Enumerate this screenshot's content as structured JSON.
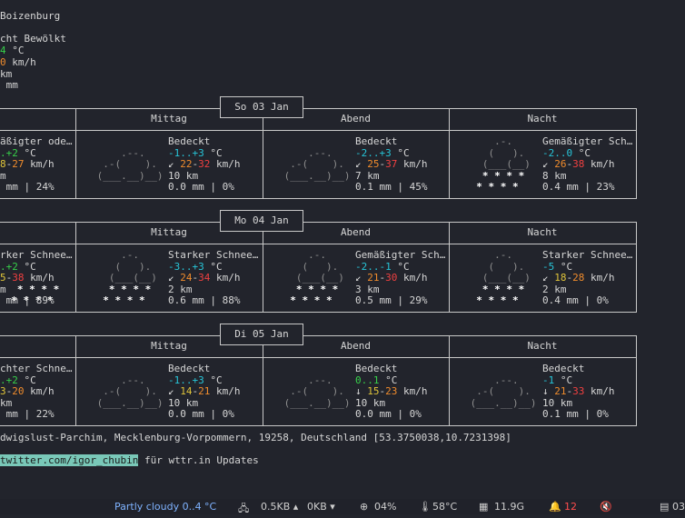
{
  "current": {
    "location": "Boizenburg",
    "condition": "cht Bewölkt",
    "temp": "4",
    "temp_unit": " °C",
    "wind": "0",
    "wind_unit": " km/h",
    "visibility": "km",
    "precip": " mm"
  },
  "days": [
    {
      "date": "So 03 Jan",
      "sections": [
        "Mittag",
        "Abend",
        "Nacht"
      ],
      "cols": [
        {
          "desc": "äßigter ode…",
          "t1": ".+2",
          "tunit": " °C",
          "w1": "8-27",
          "wunit": " km/h",
          "vis": "m",
          "pr": " mm | 24%"
        },
        {
          "desc": "Bedeckt",
          "t1": "-1..+3",
          "tunit": " °C",
          "w1": "22-32",
          "wunit": " km/h",
          "arrow": "↙ ",
          "vis": "10 km",
          "pr": "0.0 mm | 0%"
        },
        {
          "desc": "Bedeckt",
          "t1": "-2..+3",
          "tunit": " °C",
          "w1": "25-37",
          "wunit": " km/h",
          "arrow": "↙ ",
          "vis": "7 km",
          "pr": "0.1 mm | 45%"
        },
        {
          "desc": "Gemäßigter Sch…",
          "t1": "-2..0",
          "tunit": " °C",
          "w1": "26-38",
          "wunit": " km/h",
          "arrow": "↙ ",
          "vis": "8 km",
          "pr": "0.4 mm | 23%"
        }
      ]
    },
    {
      "date": "Mo 04 Jan",
      "sections": [
        "Mittag",
        "Abend",
        "Nacht"
      ],
      "cols": [
        {
          "desc": "rker Schnee…",
          "t1": ".+2",
          "tunit": " °C",
          "w1": "5-38",
          "wunit": " km/h",
          "vis": "m",
          "pr": " mm | 89%"
        },
        {
          "desc": "Starker Schnee…",
          "t1": "-3..+3",
          "tunit": " °C",
          "w1": "24-34",
          "wunit": " km/h",
          "arrow": "↙ ",
          "vis": "2 km",
          "pr": "0.6 mm | 88%"
        },
        {
          "desc": "Gemäßigter Sch…",
          "t1": "-2..-1",
          "tunit": " °C",
          "w1": "21-30",
          "wunit": " km/h",
          "arrow": "↙ ",
          "vis": "3 km",
          "pr": "0.5 mm | 29%"
        },
        {
          "desc": "Starker Schnee…",
          "t1": "-5",
          "tunit": " °C",
          "w1": "18-28",
          "wunit": " km/h",
          "arrow": "↙ ",
          "vis": "2 km",
          "pr": "0.4 mm | 0%"
        }
      ]
    },
    {
      "date": "Di 05 Jan",
      "sections": [
        "Mittag",
        "Abend",
        "Nacht"
      ],
      "cols": [
        {
          "desc": "chter Schne…",
          "t1": ".+2",
          "tunit": " °C",
          "w1": "3-20",
          "wunit": " km/h",
          "vis": "km",
          "pr": " mm | 22%"
        },
        {
          "desc": "Bedeckt",
          "t1": "-1..+3",
          "tunit": " °C",
          "w1": "14-21",
          "wunit": " km/h",
          "arrow": "↙ ",
          "vis": "10 km",
          "pr": "0.0 mm | 0%"
        },
        {
          "desc": "Bedeckt",
          "t1": "0..1",
          "tunit": " °C",
          "w1": "15-23",
          "wunit": " km/h",
          "arrow": "↓ ",
          "vis": "10 km",
          "pr": "0.0 mm | 0%"
        },
        {
          "desc": "Bedeckt",
          "t1": "-1",
          "tunit": " °C",
          "w1": "21-33",
          "wunit": " km/h",
          "arrow": "↓ ",
          "vis": "10 km",
          "pr": "0.1 mm | 0%"
        }
      ]
    }
  ],
  "footer": {
    "location": "dwigslust-Parchim, Mecklenburg-Vorpommern, 19258, Deutschland [53.3750038,10.7231398]",
    "link": "twitter.com/igor_chubin",
    "link_suffix": " für wttr.in Updates"
  },
  "statusbar": {
    "weather": "Partly cloudy 0..4 °C",
    "net_up": "0.5KB",
    "net_down": "0KB",
    "cpu": "04%",
    "temp": "58°C",
    "mem": "11.9G",
    "alerts": "12",
    "clock": "03"
  },
  "colors": {
    "accent_green": "#37d04a",
    "cyan": "#27c5d8",
    "yellow": "#e0c53a",
    "orange": "#f08c2c",
    "red": "#f04040",
    "alert": "#ff4d4d",
    "status_weather": "#7fb3ff"
  }
}
